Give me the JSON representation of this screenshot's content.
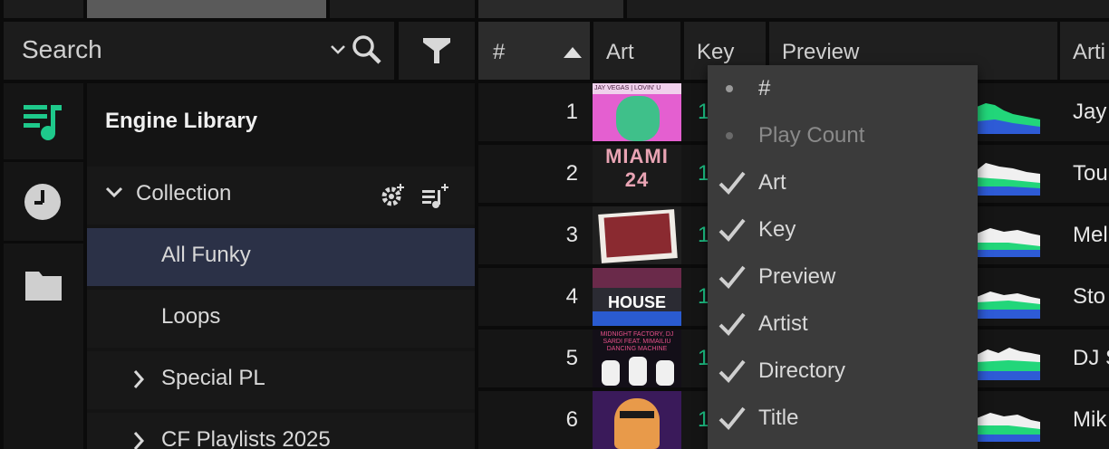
{
  "search": {
    "placeholder": "Search"
  },
  "rail": {
    "icons": [
      "playlist-icon",
      "history-icon",
      "folder-icon"
    ]
  },
  "tree": {
    "library_title": "Engine Library",
    "collection_label": "Collection",
    "items": [
      {
        "label": "All Funky",
        "selected": true
      },
      {
        "label": "Loops"
      },
      {
        "label": "Special PL"
      },
      {
        "label": "CF Playlists 2025"
      }
    ]
  },
  "table": {
    "columns": {
      "num": "#",
      "art": "Art",
      "key": "Key",
      "preview": "Preview",
      "artist": "Arti"
    },
    "rows": [
      {
        "num": "1",
        "key": "1",
        "artist": "Jay",
        "art_text": "JAY VEGAS | LOVIN' U"
      },
      {
        "num": "2",
        "key": "1",
        "artist": "Tou",
        "art_text": "MIAMI 24"
      },
      {
        "num": "3",
        "key": "1",
        "artist": "Mel",
        "art_text": ""
      },
      {
        "num": "4",
        "key": "1",
        "artist": "Sto",
        "art_text": "HOUSE"
      },
      {
        "num": "5",
        "key": "1",
        "artist": "DJ S",
        "art_text": "MIDNIGHT FACTORY, DJ SARDI FEAT. MIMAILIU DANCING MACHINE"
      },
      {
        "num": "6",
        "key": "1",
        "artist": "Mik",
        "art_text": ""
      }
    ]
  },
  "menu": {
    "items": [
      {
        "label": "#",
        "state": "dot"
      },
      {
        "label": "Play Count",
        "state": "dot-dim"
      },
      {
        "label": "Art",
        "state": "check"
      },
      {
        "label": "Key",
        "state": "check"
      },
      {
        "label": "Preview",
        "state": "check"
      },
      {
        "label": "Artist",
        "state": "check"
      },
      {
        "label": "Directory",
        "state": "check"
      },
      {
        "label": "Title",
        "state": "check"
      }
    ]
  },
  "colors": {
    "accent": "#1ec98b",
    "selected_row": "#2b3147",
    "menu_bg": "#3b3b3b"
  }
}
